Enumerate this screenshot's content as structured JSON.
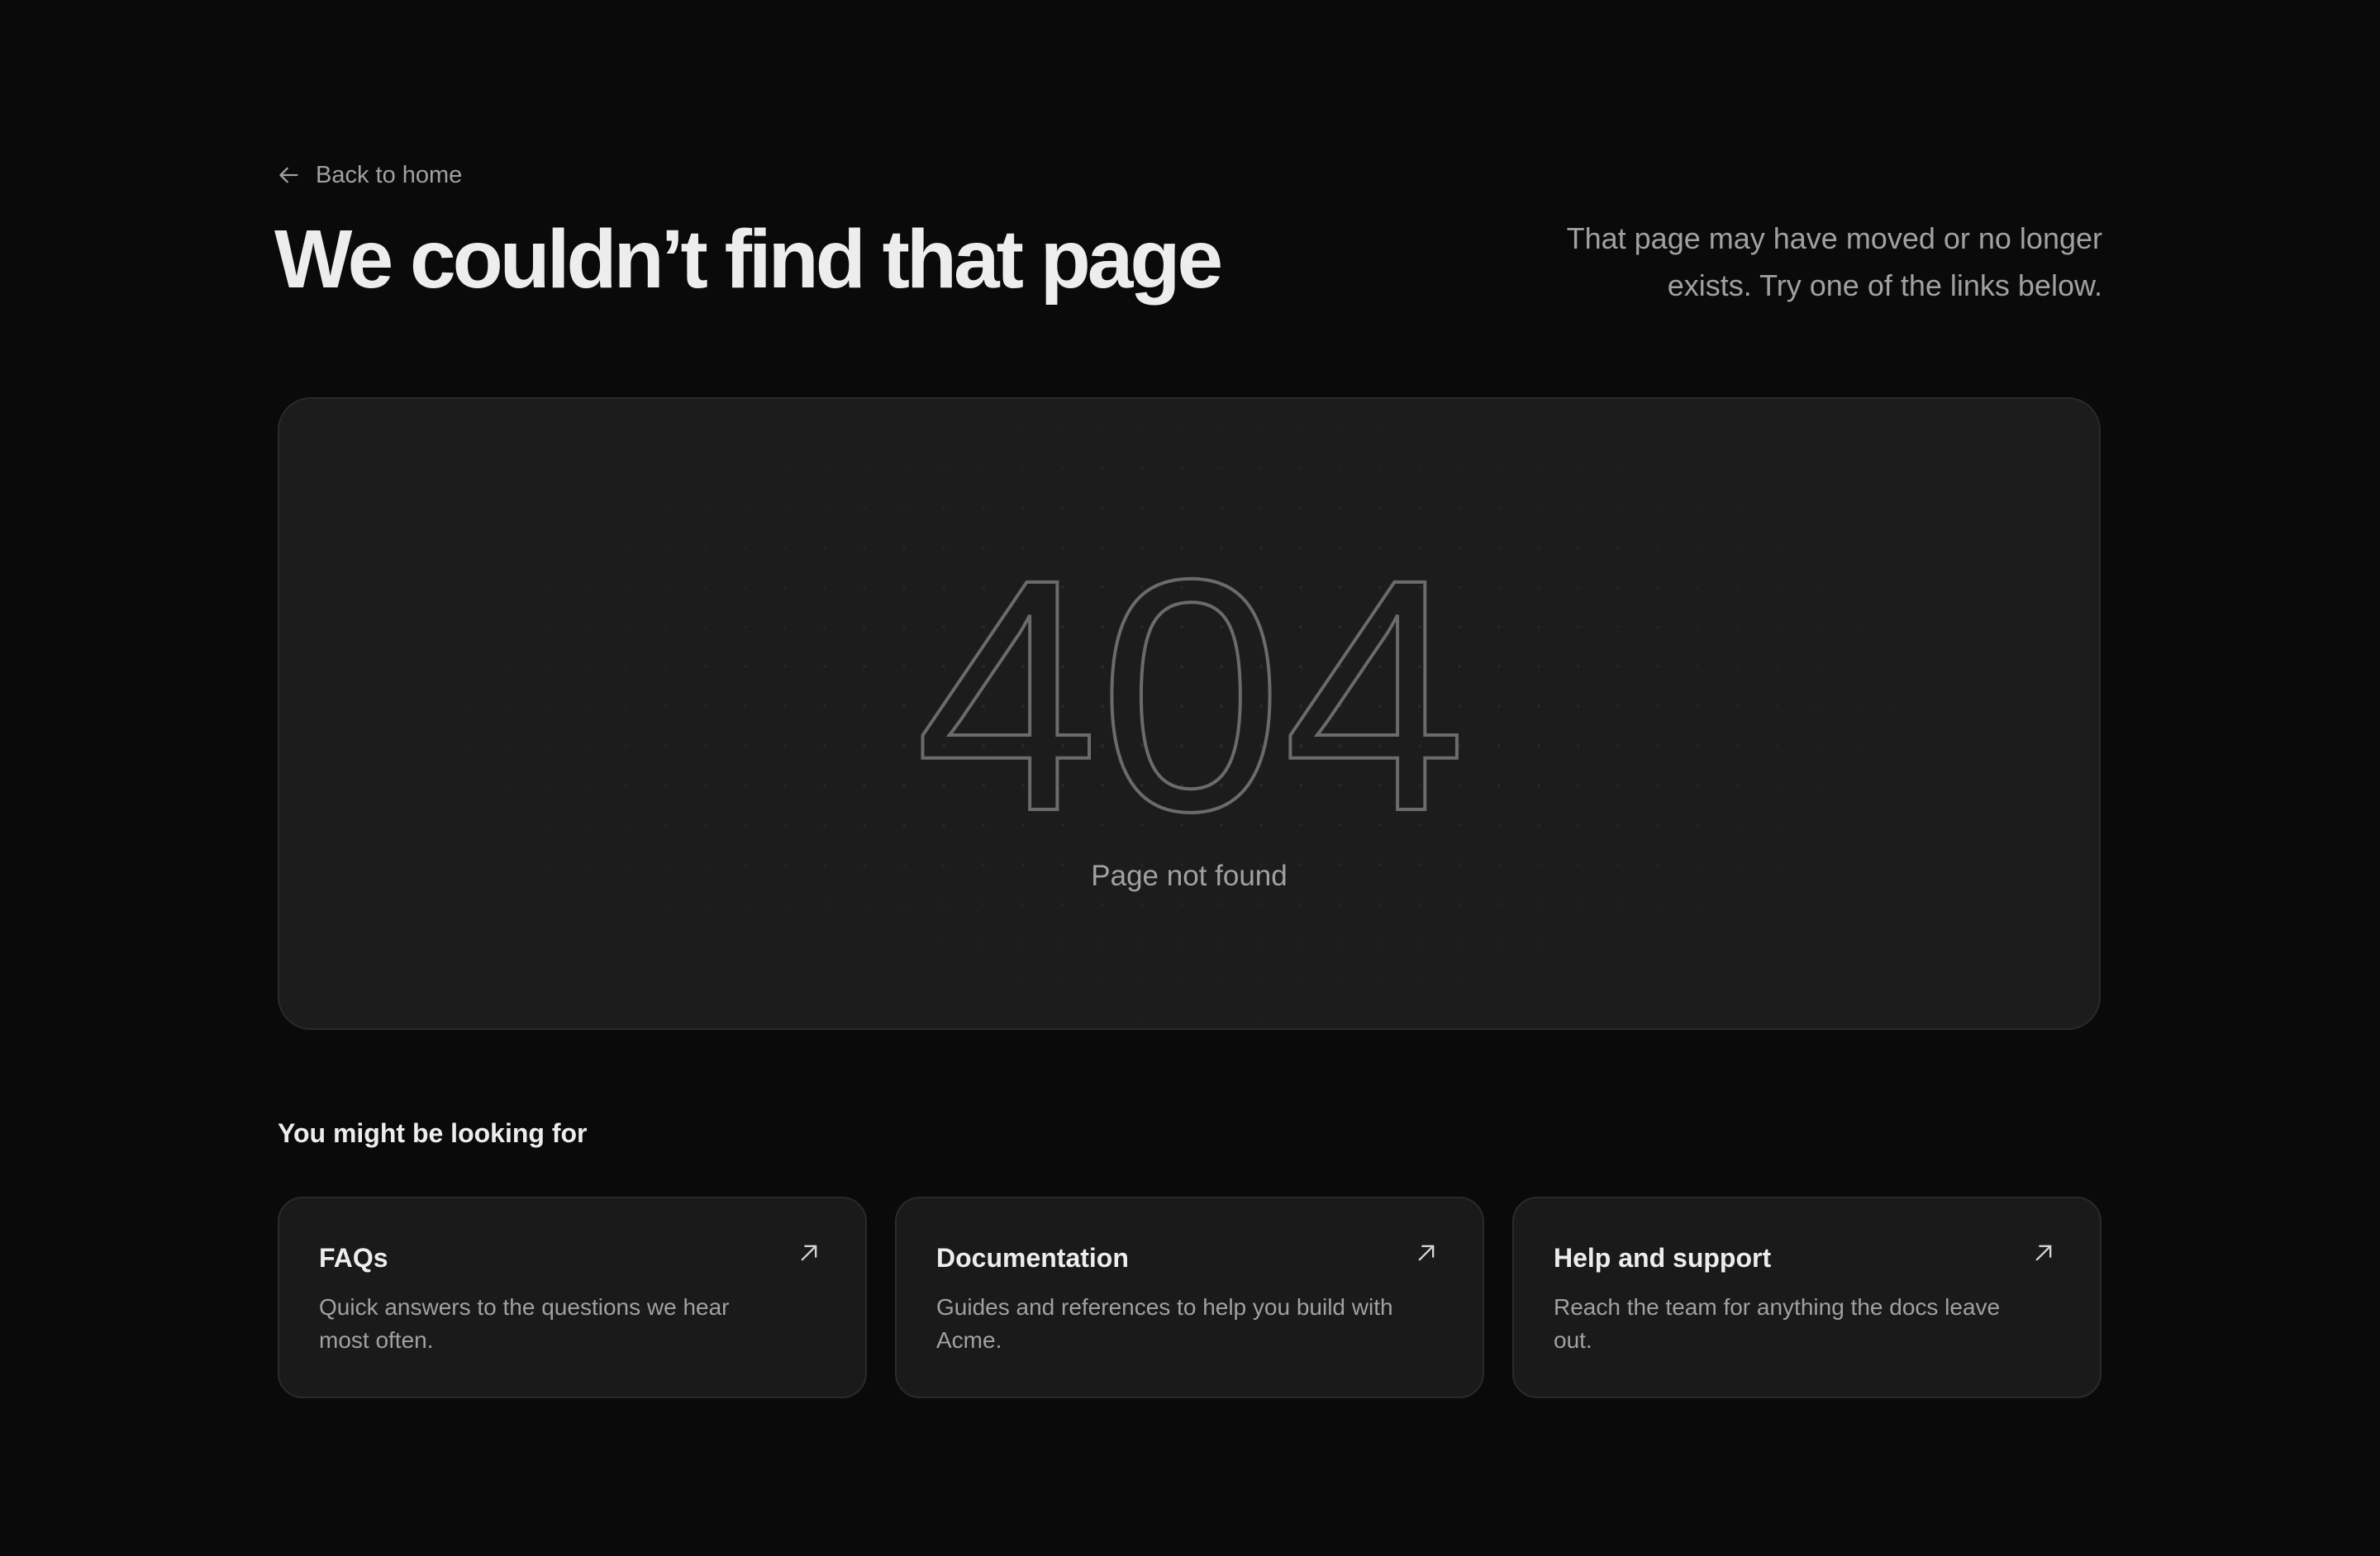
{
  "nav": {
    "back_label": "Back to home"
  },
  "header": {
    "title": "We couldn’t find that page",
    "subtitle": "That page may have moved or no longer exists. Try one of the links below."
  },
  "hero": {
    "code": "404",
    "caption": "Page not found"
  },
  "suggestions": {
    "heading": "You might be looking for",
    "items": [
      {
        "title": "FAQs",
        "description": "Quick answers to the questions we hear most often.",
        "icon": "arrow-up-right-icon"
      },
      {
        "title": "Documentation",
        "description": "Guides and references to help you build with Acme.",
        "icon": "arrow-up-right-icon"
      },
      {
        "title": "Help and support",
        "description": "Reach the team for anything the docs leave out.",
        "icon": "arrow-up-right-icon"
      }
    ]
  },
  "colors": {
    "background": "#0a0a0a",
    "surface": "#1c1c1c",
    "border": "#2a2a2a",
    "text_primary": "#ededed",
    "text_secondary": "#a1a1a1",
    "outline_stroke": "#6b6b6b"
  }
}
